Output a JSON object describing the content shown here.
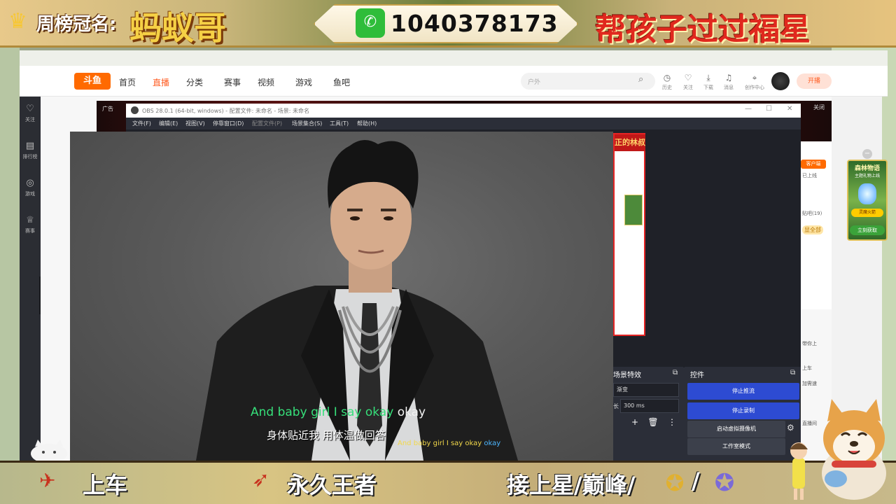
{
  "overlay_top": {
    "crown_icon": "crown-icon",
    "weekly_label": "周榜冠名:",
    "sponsor_name": "蚂蚁哥",
    "wechat_icon": "wechat-icon",
    "wechat_id": "1040378173",
    "slogan": "帮孩子过过福星"
  },
  "overlay_bottom": {
    "item1": "上车",
    "item2": "永久王者",
    "item3": "接上星/巅峰/",
    "item4": "/"
  },
  "site": {
    "logo": "斗鱼",
    "nav": [
      "首页",
      "直播",
      "分类",
      "赛事",
      "视频",
      "游戏",
      "鱼吧"
    ],
    "search_placeholder": "户外",
    "top_icons": [
      {
        "icon": "clock-icon",
        "label": "历史"
      },
      {
        "icon": "heart-icon",
        "label": "关注"
      },
      {
        "icon": "download-icon",
        "label": "下载"
      },
      {
        "icon": "bell-icon",
        "label": "消息"
      },
      {
        "icon": "location-icon",
        "label": "创作中心"
      }
    ],
    "start_button": "开播",
    "sidebar": [
      {
        "icon": "heart-icon",
        "label": "关注"
      },
      {
        "icon": "ranking-icon",
        "label": "排行榜"
      },
      {
        "icon": "mouse-icon",
        "label": "游戏"
      },
      {
        "icon": "trophy-icon",
        "label": "赛事"
      }
    ],
    "ad_label": "广告",
    "ad_close": "关闭",
    "client_button": "客户端",
    "right_text": [
      "已上线",
      "贴吧(19)",
      "显全部",
      "带你上",
      "上车",
      "加需速",
      "直播间"
    ]
  },
  "game_ad": {
    "title": "森林物语",
    "subtitle": "主题礼物上线",
    "item": "灵魔火箭",
    "button": "立刻获取"
  },
  "obs": {
    "title": "OBS 28.0.1 (64-bit, windows) - 配置文件: 未命名 - 场景: 未命名",
    "menu": [
      "文件(F)",
      "编辑(E)",
      "视图(V)",
      "停靠窗口(D)",
      "配置文件(P)",
      "场景集合(S)",
      "工具(T)",
      "帮助(H)"
    ],
    "transitions_header": "场景特效",
    "transition_value": "渐变",
    "duration_label": "长",
    "duration_value": "300 ms",
    "controls_header": "控件",
    "stop_stream": "停止推流",
    "stop_record": "停止录制",
    "virtual_cam": "启动虚拟摄像机",
    "studio_mode": "工作室模式",
    "preview_title": "正的林叔"
  },
  "lyrics": {
    "line1_sung": "And baby girl I say okay",
    "line1_rest": "okay",
    "line2": "身体贴近我 用体温做回答",
    "line3_sung": "And baby girl I say okay",
    "line3_rest": "okay"
  },
  "colors": {
    "accent": "#ff5d23",
    "obs_blue": "#2d4bd2",
    "lyric_green": "#36e07a",
    "overlay_red": "#e0281e"
  }
}
